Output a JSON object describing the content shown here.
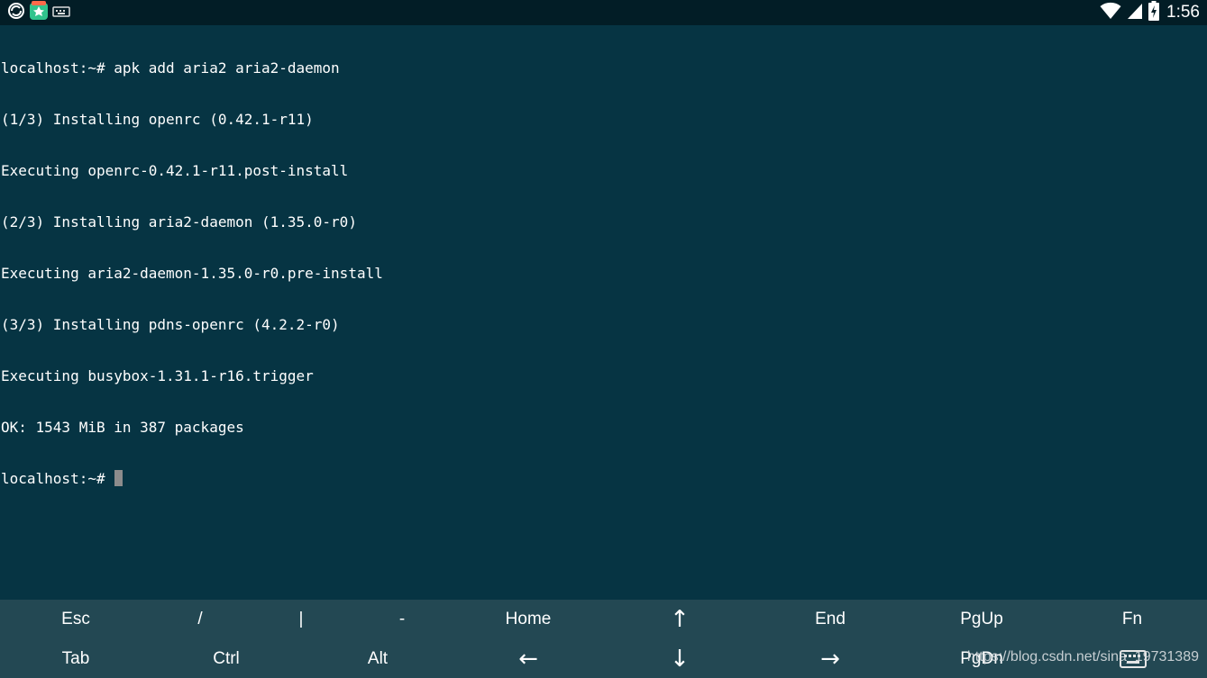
{
  "status_bar": {
    "time": "1:56",
    "left_icons": [
      "sync-icon",
      "app-store-icon",
      "keyboard-notification-icon"
    ],
    "right_icons": [
      "wifi-icon",
      "signal-icon",
      "battery-charging-icon"
    ]
  },
  "terminal": {
    "lines": [
      "localhost:~# apk add aria2 aria2-daemon",
      "(1/3) Installing openrc (0.42.1-r11)",
      "Executing openrc-0.42.1-r11.post-install",
      "(2/3) Installing aria2-daemon (1.35.0-r0)",
      "Executing aria2-daemon-1.35.0-r0.pre-install",
      "(3/3) Installing pdns-openrc (4.2.2-r0)",
      "Executing busybox-1.31.1-r16.trigger",
      "OK: 1543 MiB in 387 packages"
    ],
    "prompt": "localhost:~# "
  },
  "extra_keys": {
    "row1": [
      "Esc",
      "/",
      "|",
      "-",
      "Home",
      "↑",
      "End",
      "PgUp",
      "Fn"
    ],
    "row2": [
      "Tab",
      "Ctrl",
      "Alt",
      "←",
      "↓",
      "→",
      "PgDn"
    ]
  },
  "watermark": "https://blog.csdn.net/sina_19731389",
  "colors": {
    "terminal_bg": "#063443",
    "status_bg": "#021d26",
    "keys_bg": "#234853",
    "text": "#ffffff",
    "cursor": "#8c8c8c"
  }
}
